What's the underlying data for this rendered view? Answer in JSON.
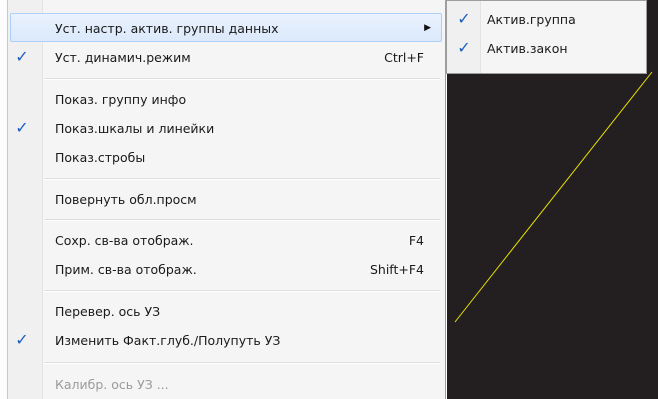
{
  "context_menu": {
    "items": [
      {
        "label": "Уст. настр. актив. группы данных",
        "shortcut": "",
        "checked": false,
        "has_submenu": true,
        "disabled": false
      },
      {
        "label": "Уст. динамич.режим",
        "shortcut": "Ctrl+F",
        "checked": true,
        "has_submenu": false,
        "disabled": false
      },
      {
        "label": "Показ. группу инфо",
        "shortcut": "",
        "checked": false,
        "has_submenu": false,
        "disabled": false
      },
      {
        "label": "Показ.шкалы и линейки",
        "shortcut": "",
        "checked": true,
        "has_submenu": false,
        "disabled": false
      },
      {
        "label": "Показ.стробы",
        "shortcut": "",
        "checked": false,
        "has_submenu": false,
        "disabled": false
      },
      {
        "label": "Повернуть обл.просм",
        "shortcut": "",
        "checked": false,
        "has_submenu": false,
        "disabled": false
      },
      {
        "label": "Сохр. св-ва отображ.",
        "shortcut": "F4",
        "checked": false,
        "has_submenu": false,
        "disabled": false
      },
      {
        "label": "Прим. св-ва отображ.",
        "shortcut": "Shift+F4",
        "checked": false,
        "has_submenu": false,
        "disabled": false
      },
      {
        "label": "Перевер. ось УЗ",
        "shortcut": "",
        "checked": false,
        "has_submenu": false,
        "disabled": false
      },
      {
        "label": "Изменить Факт.глуб./Полупуть УЗ",
        "shortcut": "",
        "checked": true,
        "has_submenu": false,
        "disabled": false
      },
      {
        "label": "Калибр. ось УЗ ...",
        "shortcut": "",
        "checked": false,
        "has_submenu": false,
        "disabled": true
      }
    ],
    "check_glyph": "✓",
    "submenu_arrow_glyph": "▶"
  },
  "submenu": {
    "items": [
      {
        "label": "Актив.группа",
        "checked": true
      },
      {
        "label": "Актив.закон",
        "checked": true
      }
    ]
  },
  "colors": {
    "canvas_background": "#231f20",
    "trace_line": "#e8e000",
    "check_mark": "#1d5fbf",
    "hover_highlight": "#dbe9fb"
  }
}
